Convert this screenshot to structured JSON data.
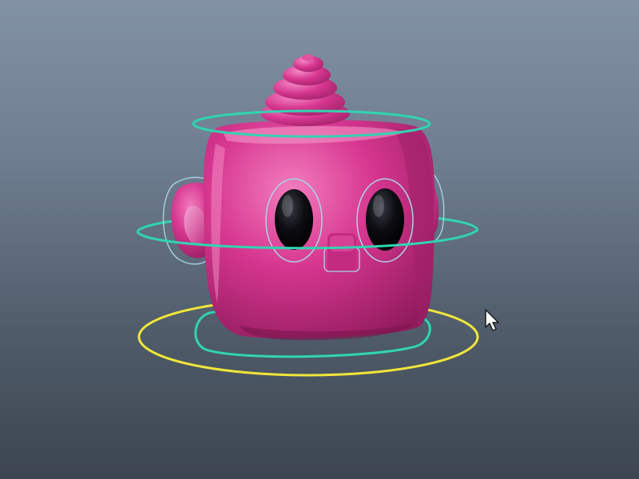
{
  "viewport": {
    "background_top": "#8292a5",
    "background_bottom": "#3c4550"
  },
  "character": {
    "body_color": "#d6368f",
    "body_highlight": "#ee6fb6",
    "body_shadow": "#8f1b5c",
    "eye_color": "#0d0d12"
  },
  "rig": {
    "root_control_color": "#f0e63a",
    "fk_control_color": "#2fd6b0",
    "selection_outline_color": "#a9d6e6"
  },
  "cursor": {
    "icon": "arrow-cursor-icon"
  }
}
